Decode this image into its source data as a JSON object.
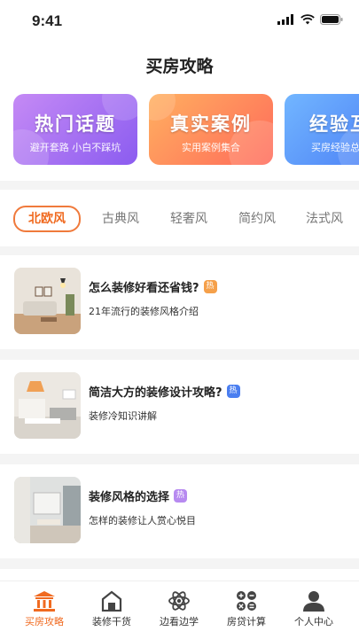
{
  "status_bar": {
    "time": "9:41"
  },
  "header": {
    "title": "买房攻略"
  },
  "banners": [
    {
      "title": "热门话题",
      "subtitle": "避开套路 小白不踩坑"
    },
    {
      "title": "真实案例",
      "subtitle": "实用案例集合"
    },
    {
      "title": "经验互",
      "subtitle": "买房经验总"
    }
  ],
  "style_tabs": [
    "北欧风",
    "古典风",
    "轻奢风",
    "简约风",
    "法式风"
  ],
  "articles": [
    {
      "title": "怎么装修好看还省钱?",
      "badge": "热",
      "badge_color": "#f5a04a",
      "subtitle": "21年流行的装修风格介绍"
    },
    {
      "title": "简洁大方的装修设计攻略?",
      "badge": "热",
      "badge_color": "#4a7ef0",
      "subtitle": "装修冷知识讲解"
    },
    {
      "title": "装修风格的选择",
      "badge": "热",
      "badge_color": "#b78af0",
      "subtitle": "怎样的装修让人赏心悦目"
    }
  ],
  "tabbar": [
    {
      "label": "买房攻略",
      "icon": "building-icon"
    },
    {
      "label": "装修干货",
      "icon": "house-icon"
    },
    {
      "label": "边看边学",
      "icon": "atom-icon"
    },
    {
      "label": "房贷计算",
      "icon": "calculator-icon"
    },
    {
      "label": "个人中心",
      "icon": "person-icon"
    }
  ],
  "colors": {
    "accent": "#f06a20"
  }
}
